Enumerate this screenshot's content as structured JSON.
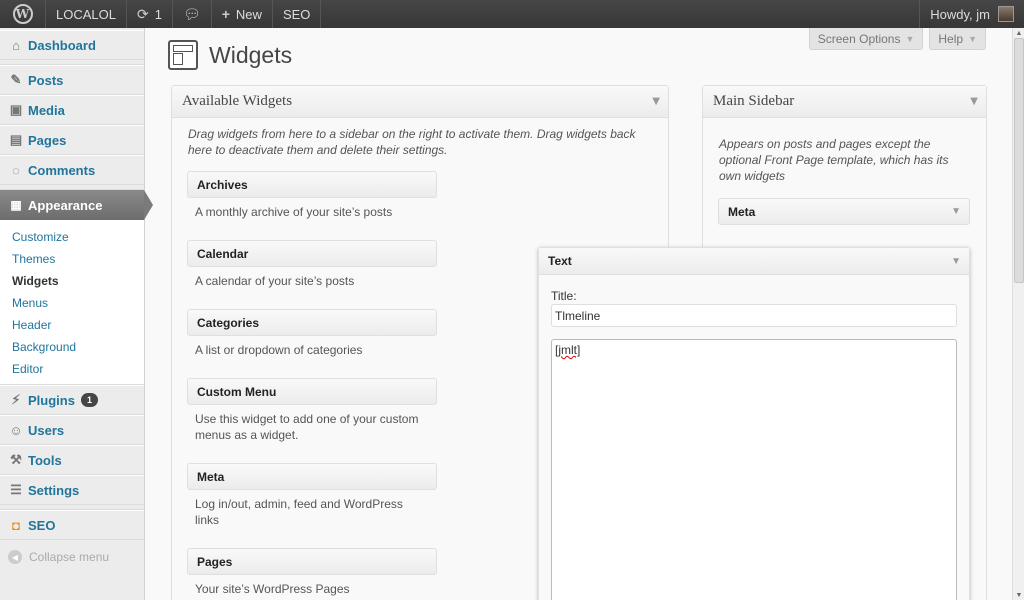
{
  "adminbar": {
    "site_name": "LOCALOL",
    "updates_count": "1",
    "new_label": "New",
    "seo_label": "SEO",
    "howdy": "Howdy, jm"
  },
  "menu": {
    "dashboard": "Dashboard",
    "posts": "Posts",
    "media": "Media",
    "pages": "Pages",
    "comments": "Comments",
    "appearance": "Appearance",
    "submenu": [
      "Customize",
      "Themes",
      "Widgets",
      "Menus",
      "Header",
      "Background",
      "Editor"
    ],
    "plugins": "Plugins",
    "plugins_badge": "1",
    "users": "Users",
    "tools": "Tools",
    "settings": "Settings",
    "seo": "SEO",
    "collapse": "Collapse menu"
  },
  "screen_options": "Screen Options",
  "help": "Help",
  "page_title": "Widgets",
  "available": {
    "title": "Available Widgets",
    "description": "Drag widgets from here to a sidebar on the right to activate them. Drag widgets back here to deactivate them and delete their settings.",
    "widgets": [
      {
        "title": "Archives",
        "desc": "A monthly archive of your site’s posts"
      },
      {
        "title": "Calendar",
        "desc": "A calendar of your site’s posts"
      },
      {
        "title": "Categories",
        "desc": "A list or dropdown of categories"
      },
      {
        "title": "Custom Menu",
        "desc": "Use this widget to add one of your custom menus as a widget."
      },
      {
        "title": "Meta",
        "desc": "Log in/out, admin, feed and WordPress links"
      },
      {
        "title": "Pages",
        "desc": "Your site’s WordPress Pages"
      }
    ]
  },
  "main_sidebar": {
    "title": "Main Sidebar",
    "description": "Appears on posts and pages except the optional Front Page template, which has its own widgets",
    "widget": "Meta"
  },
  "text_widget": {
    "title": "Text",
    "title_label": "Title:",
    "title_value": "Tlmeline",
    "content": "[jmlt]"
  }
}
